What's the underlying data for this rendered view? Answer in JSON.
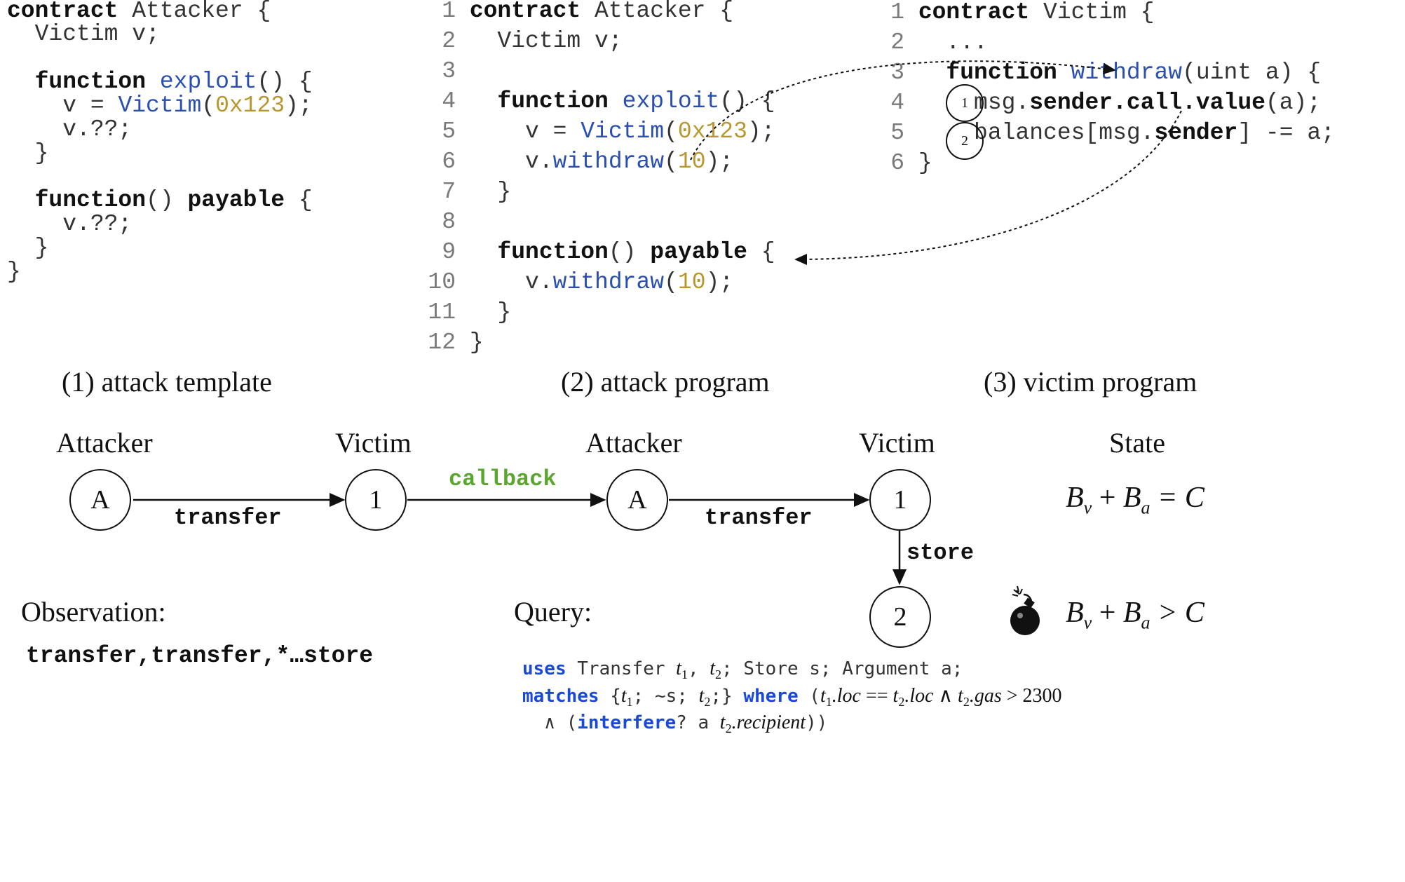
{
  "panel1": {
    "caption": "(1) attack template",
    "lines": [
      [
        "contract",
        " Attacker {"
      ],
      [
        "  Victim v;"
      ],
      [
        ""
      ],
      [
        "  ",
        "function",
        " ",
        "exploit",
        "() {"
      ],
      [
        "    v = ",
        "Victim",
        "(",
        "0x123",
        ");"
      ],
      [
        "    v.??;"
      ],
      [
        "  }"
      ],
      [
        ""
      ],
      [
        "  ",
        "function",
        "() ",
        "payable",
        " {"
      ],
      [
        "    v.??;"
      ],
      [
        "  }"
      ],
      [
        "}"
      ]
    ]
  },
  "panel2": {
    "caption": "(2) attack program",
    "line_numbers": [
      "1",
      "2",
      "3",
      "4",
      "5",
      "6",
      "7",
      "8",
      "9",
      "10",
      "11",
      "12"
    ],
    "lines": {
      "l1_kw": "contract",
      "l1_rest": " Attacker {",
      "l2": "  Victim v;",
      "l4_kw": "function",
      "l4_fn": "exploit",
      "l4_rest": "() {",
      "l5_a": "    v = ",
      "l5_fn": "Victim",
      "l5_b": "(",
      "l5_num": "0x123",
      "l5_c": ");",
      "l6_a": "    v.",
      "l6_fn": "withdraw",
      "l6_b": "(",
      "l6_num": "10",
      "l6_c": ");",
      "l7": "  }",
      "l9_kw": "function",
      "l9_b": "() ",
      "l9_kw2": "payable",
      "l9_c": " {",
      "l10_a": "    v.",
      "l10_fn": "withdraw",
      "l10_b": "(",
      "l10_num": "10",
      "l10_c": ");",
      "l11": "  }",
      "l12": "}"
    }
  },
  "panel3": {
    "caption": "(3) victim program",
    "line_numbers": [
      "1",
      "2",
      "3",
      "4",
      "5",
      "6"
    ],
    "lines": {
      "l1_kw": "contract",
      "l1_rest": " Victim {",
      "l2": "  ...",
      "l3_kw": "function",
      "l3_fn": "withdraw",
      "l3_rest": "(uint a) {",
      "l4_a": "msg.",
      "l4_k1": "sender",
      "l4_d1": ".",
      "l4_k2": "call",
      "l4_d2": ".",
      "l4_k3": "value",
      "l4_b": "(a);",
      "l5_a": "balances[msg.",
      "l5_k": "sender",
      "l5_b": "] -= a;",
      "l6": "}"
    },
    "markers": [
      "1",
      "2"
    ]
  },
  "trace": {
    "labels": [
      "Attacker",
      "Victim",
      "Attacker",
      "Victim",
      "State"
    ],
    "nodes": [
      "A",
      "1",
      "A",
      "1",
      "2"
    ],
    "edges": [
      "transfer",
      "callback",
      "transfer",
      "store"
    ],
    "callback_color": "#5aa62f",
    "state_ok": {
      "b": "B",
      "v": "v",
      "plus": " + ",
      "a": "a",
      "rel": " = C"
    },
    "state_bad": {
      "b": "B",
      "v": "v",
      "plus": " + ",
      "a": "a",
      "rel": " > C"
    },
    "bomb_icon": "bomb-icon"
  },
  "observation": {
    "label": "Observation:",
    "value": "transfer,transfer,*…store"
  },
  "query": {
    "label": "Query:",
    "l1_kw": "uses",
    "l1_a": " Transfer ",
    "t": "t",
    "one": "1",
    "two": "2",
    "l1_b": ", ",
    "l1_c": "; Store s; Argument a;",
    "l2_kw": "matches",
    "l2_a": " {",
    "l2_b": "; ~s; ",
    "l2_c": ";} ",
    "l2_kw2": "where",
    "l2_d": " (",
    "loc": ".loc",
    "eq": " == ",
    "and": " ∧ ",
    "gas": ".gas",
    "gt": " > 2300",
    "l3_a": "  ∧ (",
    "l3_kw": "interfere",
    "l3_b": "? a ",
    "recip": ".recipient",
    "l3_c": "))"
  }
}
